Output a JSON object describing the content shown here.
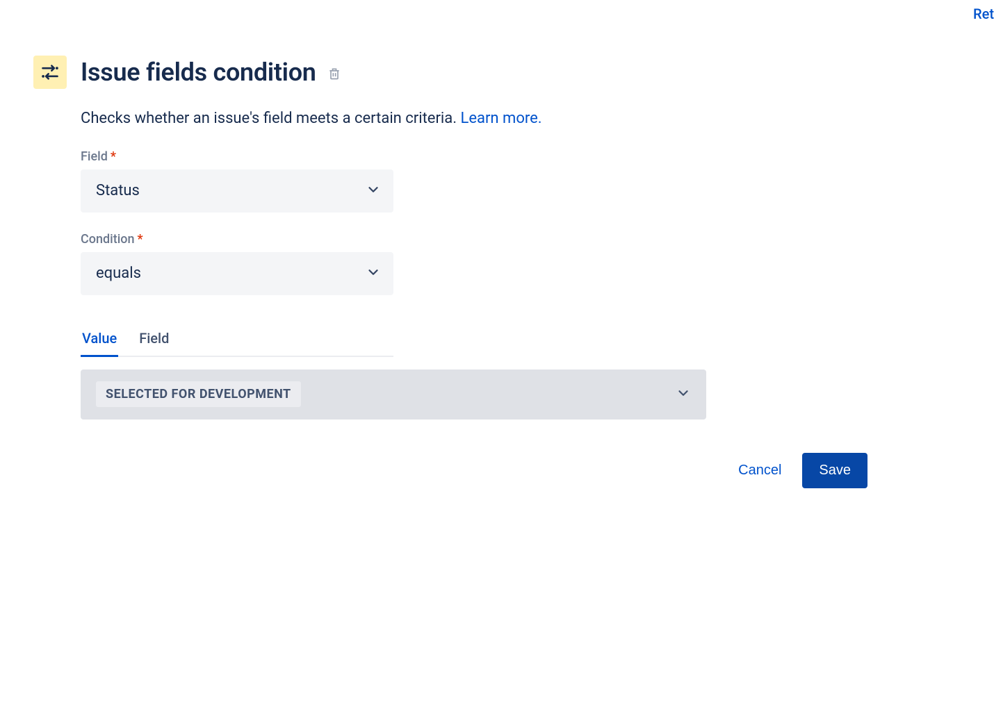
{
  "topRightLink": "Ret",
  "header": {
    "title": "Issue fields condition"
  },
  "description": {
    "text": "Checks whether an issue's field meets a certain criteria. ",
    "learnMore": "Learn more."
  },
  "form": {
    "fieldLabel": "Field",
    "fieldValue": "Status",
    "conditionLabel": "Condition",
    "conditionValue": "equals"
  },
  "tabs": {
    "value": "Value",
    "field": "Field"
  },
  "valueSelect": {
    "chip": "SELECTED FOR DEVELOPMENT"
  },
  "buttons": {
    "cancel": "Cancel",
    "save": "Save"
  }
}
